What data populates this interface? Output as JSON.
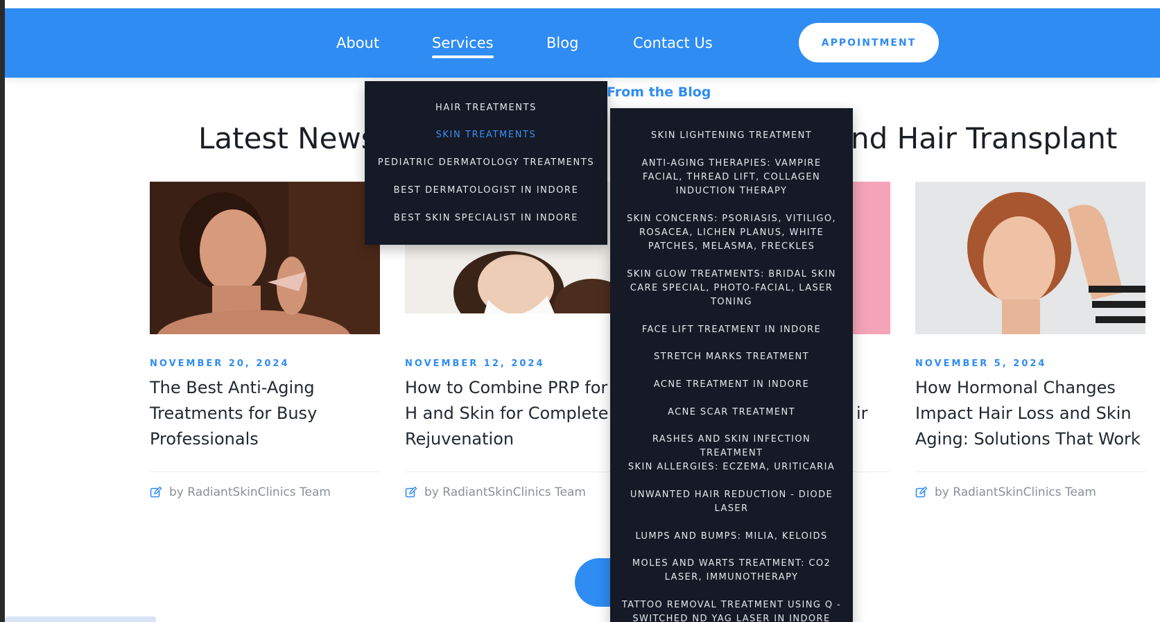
{
  "nav": {
    "items": [
      "About",
      "Services",
      "Blog",
      "Contact Us"
    ],
    "active": "Services",
    "appointment_label": "APPOINTMENT"
  },
  "blog": {
    "kicker": "From the Blog",
    "title_left": "Latest News",
    "title_right": "nd Hair Transplant"
  },
  "cards": [
    {
      "date": "NOVEMBER 20, 2024",
      "title": "The Best Anti-Aging Treatments for Busy Professionals",
      "author": "by RadiantSkinClinics Team"
    },
    {
      "date": "NOVEMBER 12, 2024",
      "title": "How to Combine PRP for H and Skin for Complete Rejuvenation",
      "author": "by RadiantSkinClinics Team"
    },
    {
      "date": "",
      "title": "ir",
      "author": ""
    },
    {
      "date": "NOVEMBER 5, 2024",
      "title": "How Hormonal Changes Impact Hair Loss and Skin Aging: Solutions That Work",
      "author": "by RadiantSkinClinics Team"
    }
  ],
  "services_menu": {
    "items": [
      "HAIR TREATMENTS",
      "SKIN TREATMENTS",
      "PEDIATRIC DERMATOLOGY TREATMENTS",
      "BEST DERMATOLOGIST IN INDORE",
      "BEST SKIN SPECIALIST IN INDORE"
    ],
    "active": "SKIN TREATMENTS"
  },
  "skin_submenu": {
    "items": [
      "SKIN LIGHTENING TREATMENT",
      "ANTI-AGING THERAPIES: VAMPIRE FACIAL, THREAD LIFT, COLLAGEN INDUCTION THERAPY",
      "SKIN CONCERNS: PSORIASIS, VITILIGO, ROSACEA, LICHEN PLANUS, WHITE PATCHES, MELASMA, FRECKLES",
      "SKIN GLOW TREATMENTS: BRIDAL SKIN CARE SPECIAL, PHOTO-FACIAL, LASER TONING",
      "FACE LIFT TREATMENT IN INDORE",
      "STRETCH MARKS TREATMENT",
      "ACNE TREATMENT IN INDORE",
      "ACNE SCAR TREATMENT",
      "RASHES AND SKIN INFECTION TREATMENT",
      "SKIN ALLERGIES: ECZEMA, URITICARIA",
      "UNWANTED HAIR REDUCTION - DIODE LASER",
      "LUMPS AND BUMPS: MILIA, KELOIDS",
      "MOLES AND WARTS TREATMENT: CO2 LASER, IMMUNOTHERAPY",
      "TATTOO REMOVAL TREATMENT USING Q - SWITCHED ND YAG LASER IN INDORE"
    ]
  },
  "colors": {
    "brand_blue": "#2f8cf2",
    "menu_bg": "#151a26",
    "menu_active": "#3d8ff5"
  }
}
